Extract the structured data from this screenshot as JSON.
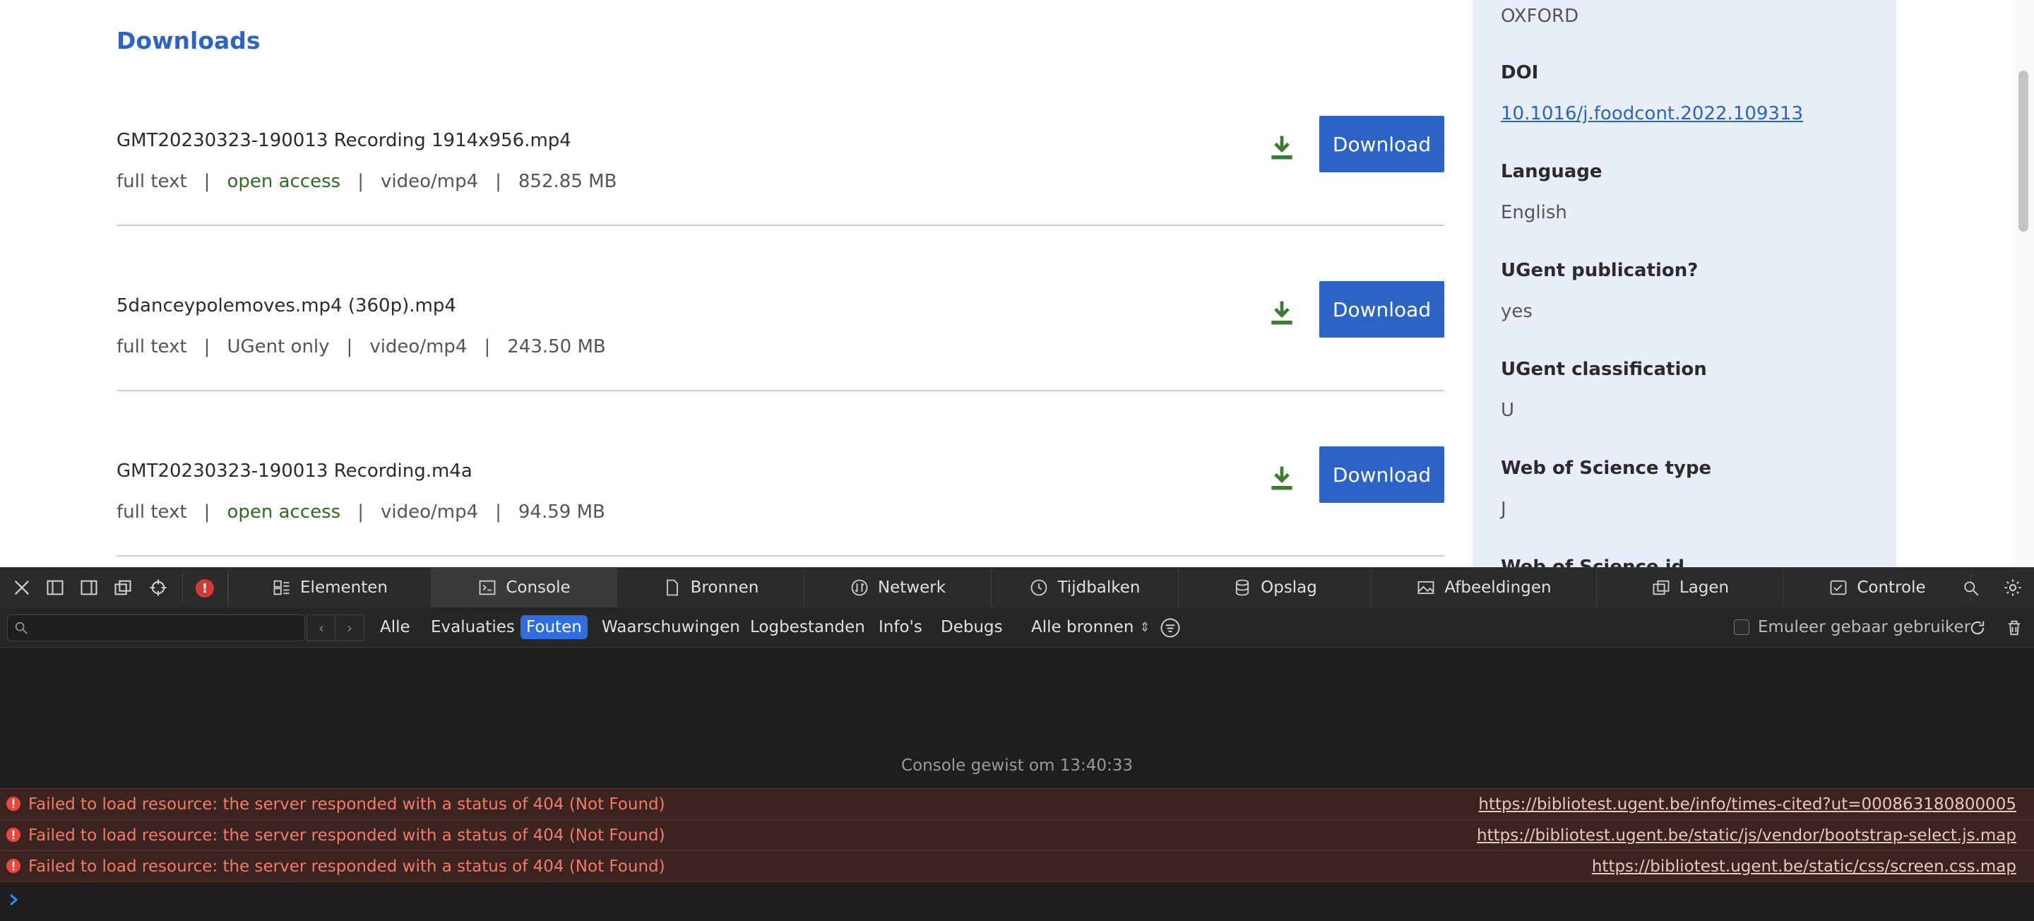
{
  "page": {
    "heading": "Downloads",
    "downloads": [
      {
        "filename": "GMT20230323-190013 Recording 1914x956.mp4",
        "type": "full text",
        "access": "open access",
        "mime": "video/mp4",
        "size": "852.85 MB",
        "button": "Download"
      },
      {
        "filename": "5danceypolemoves.mp4 (360p).mp4",
        "type": "full text",
        "access": "UGent only",
        "mime": "video/mp4",
        "size": "243.50 MB",
        "button": "Download"
      },
      {
        "filename": "GMT20230323-190013 Recording.m4a",
        "type": "full text",
        "access": "open access",
        "mime": "video/mp4",
        "size": "94.59 MB",
        "button": "Download"
      }
    ],
    "separator": "|"
  },
  "sidebar": {
    "publisher_value": "OXFORD",
    "doi_label": "DOI",
    "doi_value": "10.1016/j.foodcont.2022.109313",
    "language_label": "Language",
    "language_value": "English",
    "ugent_pub_label": "UGent publication?",
    "ugent_pub_value": "yes",
    "ugent_class_label": "UGent classification",
    "ugent_class_value": "U",
    "wos_type_label": "Web of Science type",
    "wos_type_value": "J",
    "wos_id_label": "Web of Science id"
  },
  "devtools": {
    "tabs": [
      "Elementen",
      "Console",
      "Bronnen",
      "Netwerk",
      "Tijdbalken",
      "Opslag",
      "Afbeeldingen",
      "Lagen",
      "Controle"
    ],
    "active_tab": "Console",
    "error_badge": "!",
    "filters": [
      "Alle",
      "Evaluaties",
      "Fouten",
      "Waarschuwingen",
      "Logbestanden",
      "Info's",
      "Debugs"
    ],
    "active_filter": "Fouten",
    "sources_select": "Alle bronnen",
    "emulate_label": "Emuleer gebaar gebruiker",
    "cleared_message": "Console gewist om 13:40:33",
    "errors": [
      {
        "message": "Failed to load resource: the server responded with a status of 404 (Not Found)",
        "source": "https://bibliotest.ugent.be/info/times-cited?ut=000863180800005"
      },
      {
        "message": "Failed to load resource: the server responded with a status of 404 (Not Found)",
        "source": "https://bibliotest.ugent.be/static/js/vendor/bootstrap-select.js.map"
      },
      {
        "message": "Failed to load resource: the server responded with a status of 404 (Not Found)",
        "source": "https://bibliotest.ugent.be/static/css/screen.css.map"
      }
    ],
    "colors": {
      "accent": "#2f6ee0",
      "error": "#f27a67",
      "page_accent": "#2d63c4",
      "open_access": "#2f6b23"
    }
  }
}
